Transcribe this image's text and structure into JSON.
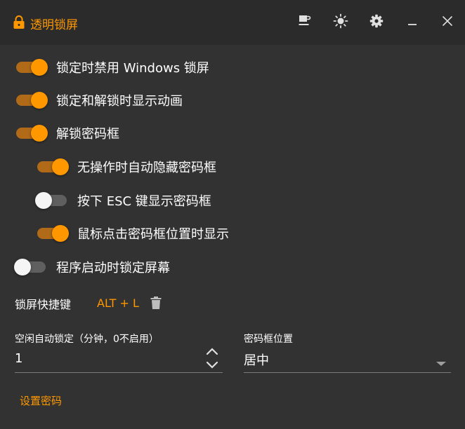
{
  "window": {
    "title": "透明锁屏",
    "colors": {
      "accent": "#ff9800",
      "background": "#323232",
      "titlebar": "#2b2b2b"
    },
    "title_icon": "lock-icon",
    "title_buttons": [
      "coffee-icon",
      "brightness-icon",
      "gear-icon",
      "minimize-icon",
      "close-icon"
    ]
  },
  "settings": {
    "disable_windows_lock": {
      "label": "锁定时禁用 Windows 锁屏",
      "enabled": true
    },
    "show_animation": {
      "label": "锁定和解锁时显示动画",
      "enabled": true
    },
    "unlock_password_box": {
      "label": "解锁密码框",
      "enabled": true
    },
    "auto_hide_box": {
      "label": "无操作时自动隐藏密码框",
      "enabled": true
    },
    "esc_show_box": {
      "label": "按下 ESC 键显示密码框",
      "enabled": false
    },
    "click_show_box": {
      "label": "鼠标点击密码框位置时显示",
      "enabled": true
    },
    "lock_on_start": {
      "label": "程序启动时锁定屏幕",
      "enabled": false
    }
  },
  "hotkey": {
    "label": "锁屏快捷键",
    "value": "ALT + L",
    "delete_icon": "trash-icon"
  },
  "idle_lock": {
    "label": "空闲自动锁定（分钟，0不启用）",
    "value": "1"
  },
  "box_position": {
    "label": "密码框位置",
    "value": "居中"
  },
  "set_password": {
    "label": "设置密码"
  }
}
